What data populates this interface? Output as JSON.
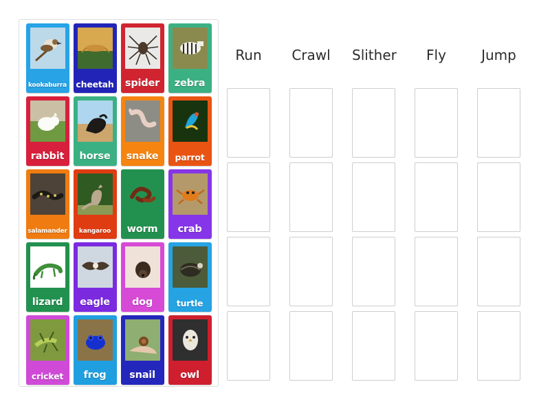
{
  "activity": {
    "type": "drag-and-drop-sorting",
    "tray_columns": 4,
    "tray_rows": 5
  },
  "tiles": [
    {
      "label": "kookaburra",
      "color": "#27a3e6",
      "label_size": "sz-sm",
      "image": "kookaburra-photo"
    },
    {
      "label": "cheetah",
      "color": "#2224b8",
      "label_size": "sz-md",
      "image": "cheetah-photo"
    },
    {
      "label": "spider",
      "color": "#d12431",
      "label_size": "sz-lg",
      "image": "spider-photo"
    },
    {
      "label": "zebra",
      "color": "#3bb183",
      "label_size": "sz-lg",
      "image": "zebra-photo"
    },
    {
      "label": "rabbit",
      "color": "#d81f3c",
      "label_size": "sz-lg",
      "image": "rabbit-photo"
    },
    {
      "label": "horse",
      "color": "#3bb183",
      "label_size": "sz-lg",
      "image": "horse-photo"
    },
    {
      "label": "snake",
      "color": "#f58410",
      "label_size": "sz-lg",
      "image": "snake-photo"
    },
    {
      "label": "parrot",
      "color": "#ea5413",
      "label_size": "sz-md",
      "image": "parrot-photo"
    },
    {
      "label": "salamander",
      "color": "#f07c11",
      "label_size": "sz-sm",
      "image": "salamander-photo"
    },
    {
      "label": "kangaroo",
      "color": "#e03c12",
      "label_size": "sz-sm",
      "image": "kangaroo-photo"
    },
    {
      "label": "worm",
      "color": "#22914f",
      "label_size": "sz-lg",
      "image": "worm-photo"
    },
    {
      "label": "crab",
      "color": "#8636e8",
      "label_size": "sz-lg",
      "image": "crab-photo"
    },
    {
      "label": "lizard",
      "color": "#22914f",
      "label_size": "sz-lg",
      "image": "lizard-photo"
    },
    {
      "label": "eagle",
      "color": "#7b2ae0",
      "label_size": "sz-lg",
      "image": "eagle-photo"
    },
    {
      "label": "dog",
      "color": "#d64ad6",
      "label_size": "sz-lg",
      "image": "dog-photo"
    },
    {
      "label": "turtle",
      "color": "#26a3e3",
      "label_size": "sz-md",
      "image": "turtle-photo"
    },
    {
      "label": "cricket",
      "color": "#d04ad8",
      "label_size": "sz-md",
      "image": "cricket-photo"
    },
    {
      "label": "frog",
      "color": "#1f9fe0",
      "label_size": "sz-lg",
      "image": "frog-photo"
    },
    {
      "label": "snail",
      "color": "#2427bb",
      "label_size": "sz-lg",
      "image": "snail-photo"
    },
    {
      "label": "owl",
      "color": "#cf1f2e",
      "label_size": "sz-lg",
      "image": "owl-photo"
    }
  ],
  "board": {
    "columns": [
      {
        "label": "Run"
      },
      {
        "label": "Crawl"
      },
      {
        "label": "Slither"
      },
      {
        "label": "Fly"
      },
      {
        "label": "Jump"
      }
    ],
    "rows": 4,
    "zone_contents": [
      [
        "",
        "",
        "",
        "",
        ""
      ],
      [
        "",
        "",
        "",
        "",
        ""
      ],
      [
        "",
        "",
        "",
        "",
        ""
      ],
      [
        "",
        "",
        "",
        "",
        ""
      ]
    ]
  },
  "colors": {
    "page_background": "#ffffff",
    "tray_border": "#dcdcdc",
    "dropzone_border": "#cdcdcd",
    "header_text": "#2b2b2b",
    "tile_label_text": "#ffffff"
  }
}
